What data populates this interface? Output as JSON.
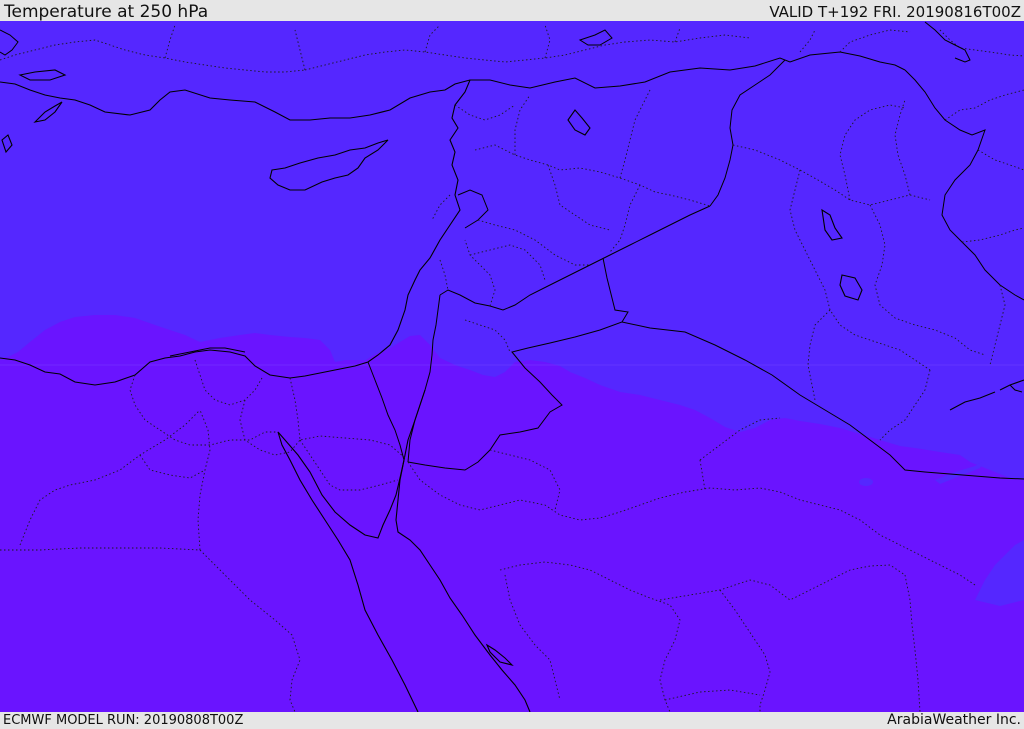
{
  "header": {
    "title": "Temperature at 250 hPa",
    "valid_time": "VALID T+192 FRI. 20190816T00Z"
  },
  "footer": {
    "model_run": "ECMWF MODEL RUN: 20190808T00Z",
    "credit": "ArabiaWeather Inc."
  },
  "map": {
    "colors": {
      "cooler_zone": "#5527ff",
      "warmer_zone": "#6a14ff",
      "coastline": "#000000",
      "country_border": "#000000",
      "internal_boundary": "#1a1a1a"
    },
    "features": [
      "mediterranean-sea",
      "cyprus",
      "crete",
      "sinai",
      "red-sea",
      "gulf-of-aqaba",
      "gulf-of-suez",
      "nile-delta",
      "iraq",
      "syria",
      "jordan",
      "saudi-arabia",
      "egypt",
      "turkey"
    ]
  }
}
